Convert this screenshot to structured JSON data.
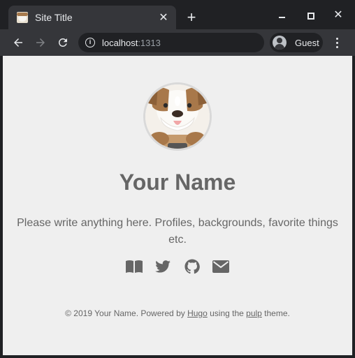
{
  "browser": {
    "tab_title": "Site Title",
    "tab_close": "✕",
    "new_tab": "+",
    "window_close": "✕",
    "url_host": "localhost",
    "url_port": ":1313",
    "profile_label": "Guest",
    "info_glyph": "i"
  },
  "page": {
    "name": "Your Name",
    "bio": "Please write anything here. Profiles, backgrounds, favorite things etc.",
    "socials": [
      {
        "icon": "book-icon"
      },
      {
        "icon": "twitter-icon"
      },
      {
        "icon": "github-icon"
      },
      {
        "icon": "mail-icon"
      }
    ],
    "footer": {
      "prefix": "© 2019 Your Name. Powered by ",
      "hugo_link": "Hugo",
      "middle": " using the ",
      "theme_link": "pulp",
      "suffix": " theme."
    }
  },
  "colors": {
    "chrome_dark": "#202124",
    "chrome_toolbar": "#35363a",
    "page_bg": "#efefef",
    "text": "#666666"
  }
}
